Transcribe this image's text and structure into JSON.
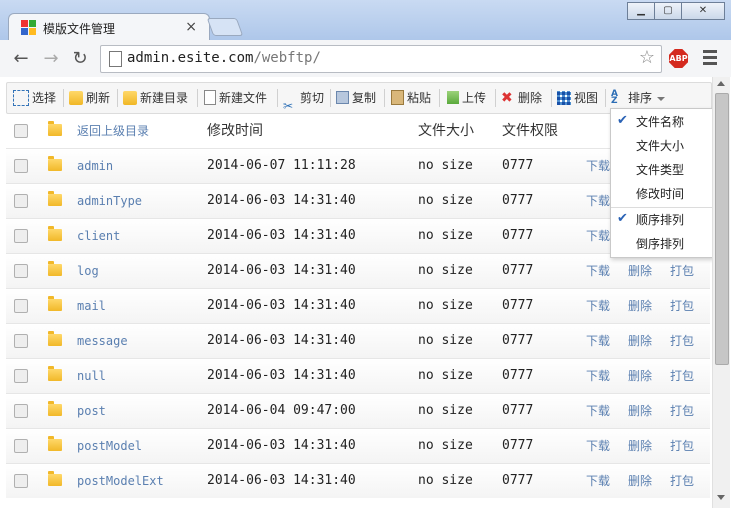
{
  "browser": {
    "tab_title": "模版文件管理",
    "close_glyph": "×",
    "url_host": "admin.esite.com",
    "url_path": "/webftp/",
    "abp_label": "ABP",
    "window_controls": [
      "▁",
      "▢",
      "✕"
    ]
  },
  "toolbar": {
    "select": "选择",
    "refresh": "刷新",
    "new_dir": "新建目录",
    "new_file": "新建文件",
    "cut": "剪切",
    "copy": "复制",
    "paste": "粘贴",
    "upload": "上传",
    "delete": "删除",
    "view": "视图",
    "sort": "排序"
  },
  "table": {
    "headers": {
      "name": "返回上级目录",
      "mtime": "修改时间",
      "size": "文件大小",
      "perm": "文件权限"
    },
    "rows": [
      {
        "name": "admin",
        "mtime": "2014-06-07 11:11:28",
        "size": "no size",
        "perm": "0777"
      },
      {
        "name": "adminType",
        "mtime": "2014-06-03 14:31:40",
        "size": "no size",
        "perm": "0777"
      },
      {
        "name": "client",
        "mtime": "2014-06-03 14:31:40",
        "size": "no size",
        "perm": "0777"
      },
      {
        "name": "log",
        "mtime": "2014-06-03 14:31:40",
        "size": "no size",
        "perm": "0777"
      },
      {
        "name": "mail",
        "mtime": "2014-06-03 14:31:40",
        "size": "no size",
        "perm": "0777"
      },
      {
        "name": "message",
        "mtime": "2014-06-03 14:31:40",
        "size": "no size",
        "perm": "0777"
      },
      {
        "name": "null",
        "mtime": "2014-06-03 14:31:40",
        "size": "no size",
        "perm": "0777"
      },
      {
        "name": "post",
        "mtime": "2014-06-04 09:47:00",
        "size": "no size",
        "perm": "0777"
      },
      {
        "name": "postModel",
        "mtime": "2014-06-03 14:31:40",
        "size": "no size",
        "perm": "0777"
      },
      {
        "name": "postModelExt",
        "mtime": "2014-06-03 14:31:40",
        "size": "no size",
        "perm": "0777"
      }
    ],
    "actions": {
      "download": "下载",
      "delete": "删除",
      "pack": "打包"
    }
  },
  "sort_menu": {
    "items": [
      {
        "label": "文件名称",
        "checked": true
      },
      {
        "label": "文件大小",
        "checked": false
      },
      {
        "label": "文件类型",
        "checked": false
      },
      {
        "label": "修改时间",
        "checked": false
      },
      {
        "label": "顺序排列",
        "checked": true
      },
      {
        "label": "倒序排列",
        "checked": false
      }
    ]
  }
}
